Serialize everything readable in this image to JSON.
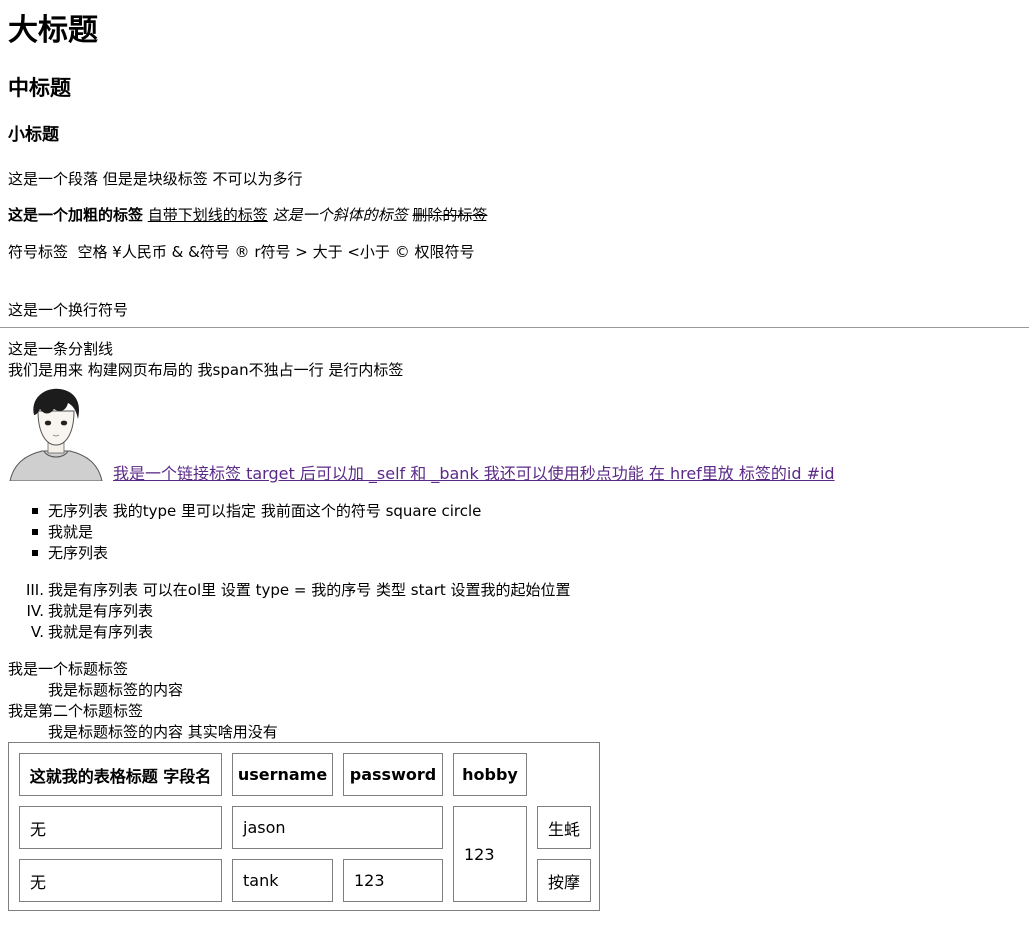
{
  "headings": {
    "h1": "大标题",
    "h2": "中标题",
    "h3": "小标题"
  },
  "paragraph": "这是一个段落 但是是块级标签 不可以为多行",
  "formatting": {
    "bold": "这是一个加粗的标签",
    "underline": "自带下划线的标签",
    "italic": "这是一个斜体的标签",
    "strike": "删除的标签"
  },
  "entities": "符号标签  空格 ¥人民币 & &符号 ® r符号 > 大于 <小于 © 权限符号",
  "br_text": "这是一个换行符号",
  "hr_text": "这是一条分割线",
  "span_text": "我们是用来 构建网页布局的 我span不独占一行 是行内标签",
  "link_text": "我是一个链接标签 target 后可以加 _self 和 _bank 我还可以使用秒点功能 在 href里放 标签的id #id",
  "unordered_list": [
    "无序列表 我的type 里可以指定 我前面这个的符号 square circle",
    "我就是",
    "无序列表"
  ],
  "ordered_list": {
    "markers": [
      "III.",
      "IV.",
      "V."
    ],
    "items": [
      "我是有序列表 可以在ol里 设置 type = 我的序号 类型 start 设置我的起始位置",
      "我就是有序列表",
      "我就是有序列表"
    ]
  },
  "definition_list": [
    {
      "term": "我是一个标题标签",
      "desc": "我是标题标签的内容"
    },
    {
      "term": "我是第二个标题标签",
      "desc": "我是标题标签的内容 其实啥用没有"
    }
  ],
  "table": {
    "headers": [
      "这就我的表格标题 字段名",
      "username",
      "password",
      "hobby"
    ],
    "row1": [
      "无",
      "jason",
      "123",
      "生蚝"
    ],
    "row2": [
      "无",
      "tank",
      "123",
      "按摩"
    ]
  },
  "colors": {
    "link": "#5b2a86",
    "border": "#7f7f7f"
  },
  "icons": {
    "avatar": "anime-boy-avatar"
  }
}
